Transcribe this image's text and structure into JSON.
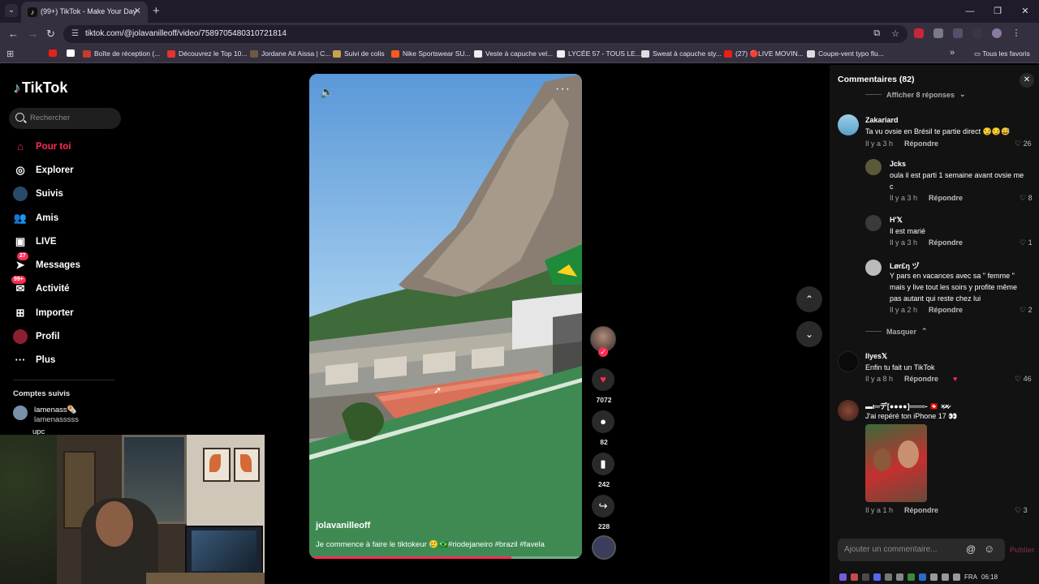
{
  "browser": {
    "tab_title": "(99+) TikTok - Make Your Day",
    "url": "tiktok.com/@jolavanilleoff/video/7589705480310721814",
    "bookmarks": [
      "Boîte de réception (...",
      "Découvrez le Top 10...",
      "Jordane Ait Aissa | C...",
      "Suivi de colis",
      "Nike Sportswear SU...",
      "Veste à capuche vel...",
      "LYCÉE 57 - TOUS LE...",
      "Sweat à capuche sty...",
      "(27) 🔴LIVE MOVIN...",
      "Coupe-vent typo flu..."
    ],
    "all_favorites": "Tous les favoris"
  },
  "sidebar": {
    "logo": "TikTok",
    "search_placeholder": "Rechercher",
    "items": [
      {
        "label": "Pour toi",
        "icon": "home-icon"
      },
      {
        "label": "Explorer",
        "icon": "compass-icon"
      },
      {
        "label": "Suivis",
        "icon": "following-icon"
      },
      {
        "label": "Amis",
        "icon": "friends-icon"
      },
      {
        "label": "LIVE",
        "icon": "live-icon"
      },
      {
        "label": "Messages",
        "icon": "messages-icon",
        "badge": "27"
      },
      {
        "label": "Activité",
        "icon": "activity-icon",
        "badge": "99+"
      },
      {
        "label": "Importer",
        "icon": "upload-icon"
      },
      {
        "label": "Profil",
        "icon": "profile-icon"
      },
      {
        "label": "Plus",
        "icon": "more-icon"
      }
    ],
    "followed_title": "Comptes suivis",
    "followed": [
      {
        "name": "lamenass🌯",
        "handle": "lamenasssss"
      },
      {
        "name": "upc",
        "handle": ""
      }
    ]
  },
  "video": {
    "author": "jolavanilleoff",
    "caption": "Je commence à faire le tiktokeur 🥲🇧🇷#riodejaneiro #brazil #favela",
    "progress": 0.74
  },
  "actions": {
    "likes": "7072",
    "comments": "82",
    "saves": "242",
    "shares": "228"
  },
  "comments_panel": {
    "title": "Commentaires (82)",
    "show_replies": "Afficher 8 réponses",
    "hide_replies": "Masquer",
    "reply_label": "Répondre",
    "comments": [
      {
        "user": "Zakariard",
        "text": "Ta vu ovsie en Brésil te partie direct 😏😏😅",
        "time": "Il y a 3 h",
        "likes": "26"
      },
      {
        "user": "Jcks",
        "text": "oula il est parti 1 semaine avant ovsie me c",
        "time": "Il y a 3 h",
        "likes": "8"
      },
      {
        "user": "H'𝕏",
        "text": "Il est marié",
        "time": "Il y a 3 h",
        "likes": "1"
      },
      {
        "user": "Lør£ŋ ヅ",
        "text": "Y pars en vacances avec sa \" femme \" mais y live tout les soirs y profite même pas autant qui reste chez lui",
        "time": "Il y a 2 h",
        "likes": "2"
      },
      {
        "user": "Ilyes𝕏",
        "text": "Enfin tu fait un TikTok",
        "time": "Il y a 8 h",
        "likes": "46"
      },
      {
        "user": "▬ι═デ[●●●●]═══- 🇨🇭 ×̷×̷",
        "text": "J'ai repéré ton iPhone 17 👀",
        "time": "Il y a 1 h",
        "likes": "3"
      }
    ],
    "input_placeholder": "Ajouter un commentaire...",
    "publish": "Publier"
  },
  "taskbar": {
    "language": "FRA",
    "time": "06:18"
  },
  "colors": {
    "accent": "#fe2c55",
    "panel": "#121212",
    "browser_frame": "#35303f"
  }
}
